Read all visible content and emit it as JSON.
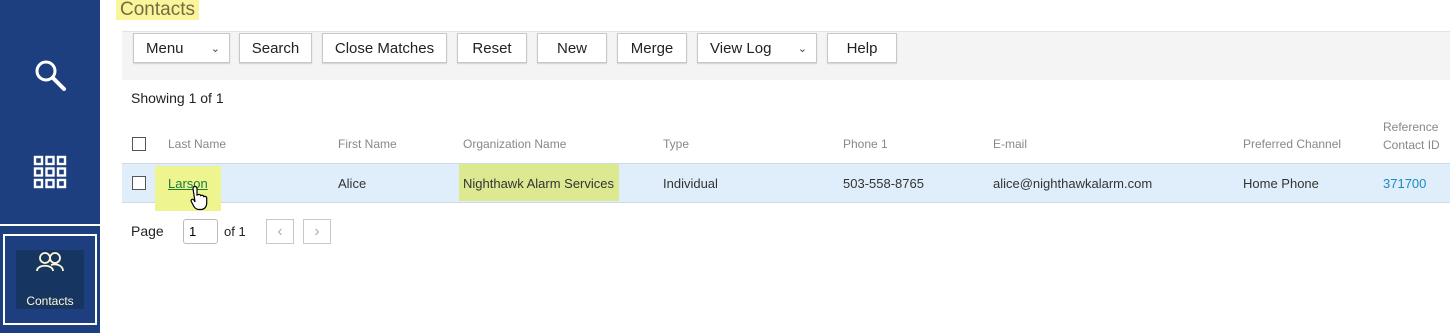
{
  "page": {
    "title": "Contacts"
  },
  "sidebar": {
    "items": [
      {
        "icon": "search-icon",
        "label": ""
      },
      {
        "icon": "grid-icon",
        "label": ""
      },
      {
        "icon": "contacts-icon",
        "label": "Contacts",
        "active": true
      }
    ]
  },
  "toolbar": {
    "menu_label": "Menu",
    "search_label": "Search",
    "close_matches_label": "Close Matches",
    "reset_label": "Reset",
    "new_label": "New",
    "merge_label": "Merge",
    "view_log_label": "View Log",
    "help_label": "Help"
  },
  "results": {
    "showing_text": "Showing 1 of 1"
  },
  "table": {
    "columns": {
      "last_name": "Last Name",
      "first_name": "First Name",
      "organization": "Organization Name",
      "type": "Type",
      "phone1": "Phone 1",
      "email": "E-mail",
      "preferred_channel": "Preferred Channel",
      "reference_line1": "Reference",
      "reference_line2": "Contact ID"
    },
    "rows": [
      {
        "last_name": "Larson",
        "first_name": "Alice",
        "organization": "Nighthawk Alarm Services",
        "type": "Individual",
        "phone1": "503-558-8765",
        "email": "alice@nighthawkalarm.com",
        "preferred_channel": "Home Phone",
        "reference_contact_id": "371700"
      }
    ]
  },
  "pager": {
    "page_label": "Page",
    "page_value": "1",
    "of_label": "of 1"
  },
  "colors": {
    "sidebar": "#1e3f7f",
    "highlight": "#f8f59b",
    "row": "#dfeefa",
    "link": "#1b8ac4"
  }
}
